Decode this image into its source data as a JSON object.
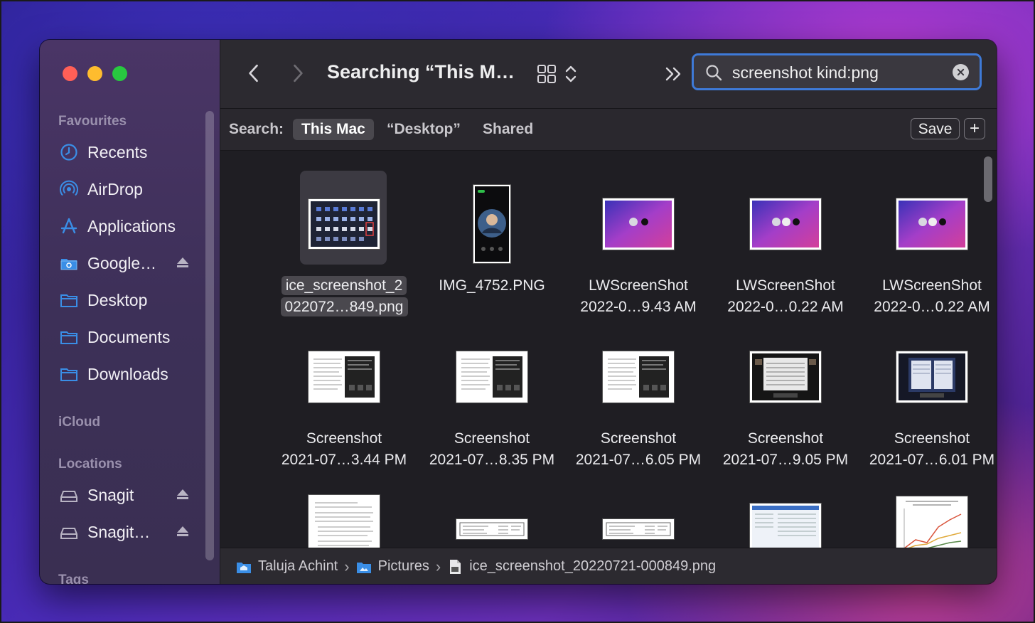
{
  "window": {
    "title": "Searching “This M…"
  },
  "sidebar": {
    "sections": [
      {
        "heading": "Favourites"
      },
      {
        "heading": "iCloud"
      },
      {
        "heading": "Locations"
      },
      {
        "heading": "Tags"
      }
    ],
    "favourites": [
      {
        "label": "Recents",
        "icon": "clock-icon"
      },
      {
        "label": "AirDrop",
        "icon": "airdrop-icon"
      },
      {
        "label": "Applications",
        "icon": "applications-icon"
      },
      {
        "label": "Google…",
        "icon": "folder-icon",
        "eject": true
      },
      {
        "label": "Desktop",
        "icon": "folder-icon"
      },
      {
        "label": "Documents",
        "icon": "folder-icon"
      },
      {
        "label": "Downloads",
        "icon": "folder-icon"
      }
    ],
    "locations": [
      {
        "label": "Snagit",
        "icon": "drive-icon",
        "eject": true
      },
      {
        "label": "Snagit…",
        "icon": "drive-icon",
        "eject": true
      }
    ]
  },
  "search": {
    "query": "screenshot kind:png"
  },
  "scope": {
    "label": "Search:",
    "options": [
      "This Mac",
      "“Desktop”",
      "Shared"
    ],
    "active": "This Mac",
    "save_label": "Save",
    "add_label": "+"
  },
  "files": [
    {
      "line1": "ice_screenshot_2",
      "line2": "022072…849.png",
      "selected": true
    },
    {
      "line1": "IMG_4752.PNG",
      "line2": ""
    },
    {
      "line1": "LWScreenShot",
      "line2": "2022-0…9.43 AM"
    },
    {
      "line1": "LWScreenShot",
      "line2": "2022-0…0.22 AM"
    },
    {
      "line1": "LWScreenShot",
      "line2": "2022-0…0.22 AM"
    },
    {
      "line1": "Screenshot",
      "line2": "2021-07…3.44 PM"
    },
    {
      "line1": "Screenshot",
      "line2": "2021-07…8.35 PM"
    },
    {
      "line1": "Screenshot",
      "line2": "2021-07…6.05 PM"
    },
    {
      "line1": "Screenshot",
      "line2": "2021-07…9.05 PM"
    },
    {
      "line1": "Screenshot",
      "line2": "2021-07…6.01 PM"
    }
  ],
  "pathbar": {
    "crumbs": [
      "Taluja Achint",
      "Pictures",
      "ice_screenshot_20220721-000849.png"
    ]
  },
  "colors": {
    "accent": "#3e7ad8",
    "sidebar_icon": "#3a8ee6"
  }
}
